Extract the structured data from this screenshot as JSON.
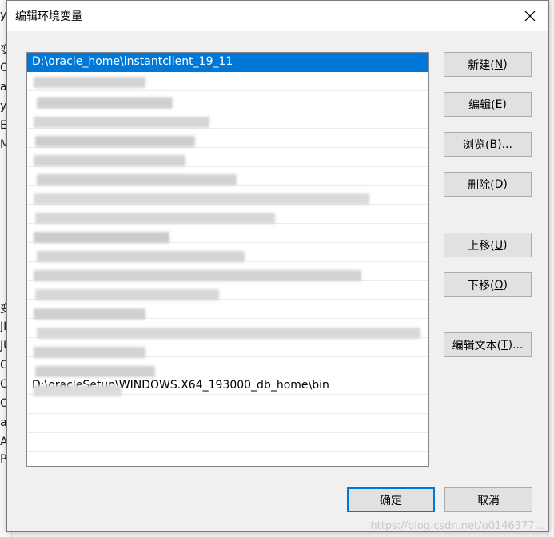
{
  "dialog": {
    "title": "编辑环境变量",
    "close_icon": "close-icon"
  },
  "list": {
    "selected_path": "D:\\oracle_home\\instantclient_19_11",
    "last_visible_path": "D:\\oracleSetup\\WINDOWS.X64_193000_db_home\\bin"
  },
  "buttons": {
    "new": {
      "text": "新建(",
      "key": "N",
      "end": ")"
    },
    "edit": {
      "text": "编辑(",
      "key": "E",
      "end": ")"
    },
    "browse": {
      "text": "浏览(",
      "key": "B",
      "end": ")..."
    },
    "delete": {
      "text": "删除(",
      "key": "D",
      "end": ")"
    },
    "move_up": {
      "text": "上移(",
      "key": "U",
      "end": ")"
    },
    "move_down": {
      "text": "下移(",
      "key": "O",
      "end": ")"
    },
    "edit_text": {
      "text": "编辑文本(",
      "key": "T",
      "end": ")..."
    },
    "ok": "确定",
    "cancel": "取消"
  },
  "background_chars": [
    "y",
    "变",
    "Or",
    "a",
    "y",
    "E",
    "M",
    "变",
    "JL",
    "JU",
    "OF",
    "OF",
    "OS",
    "a",
    "A",
    "P"
  ],
  "watermark": "https://blog.csdn.net/u0146377..."
}
